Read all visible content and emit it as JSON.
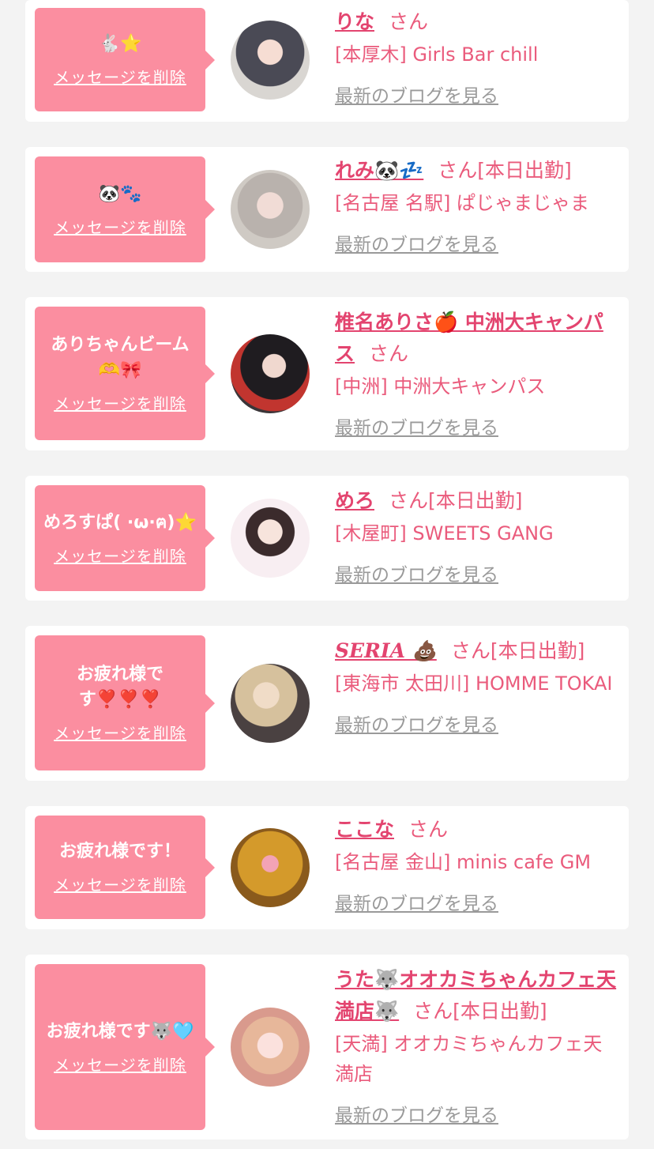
{
  "messages": [
    {
      "message": "🐇⭐",
      "delete_label": "メッセージを削除",
      "name": "りな",
      "honorific": "さん",
      "status": "",
      "shop": "[本厚木] Girls Bar chill",
      "blog_label": "最新のブログを見る"
    },
    {
      "message": "🐼🐾",
      "delete_label": "メッセージを削除",
      "name": "れみ🐼💤",
      "honorific": "さん",
      "status": "[本日出勤]",
      "shop": "[名古屋 名駅] ぱじゃまじゃま",
      "blog_label": "最新のブログを見る"
    },
    {
      "message": "ありちゃんビーム🫶🎀",
      "delete_label": "メッセージを削除",
      "name": "椎名ありさ🍎 中洲大キャンパス",
      "honorific": "さん",
      "status": "",
      "shop": "[中洲] 中洲大キャンパス",
      "blog_label": "最新のブログを見る"
    },
    {
      "message": "めろすぱ( ·ω·ฅ)⭐",
      "delete_label": "メッセージを削除",
      "name": "めろ",
      "honorific": "さん",
      "status": "[本日出勤]",
      "shop": "[木屋町] SWEETS GANG",
      "blog_label": "最新のブログを見る"
    },
    {
      "message": "お疲れ様です❣️❣️❣️",
      "delete_label": "メッセージを削除",
      "name": "SERIA 💩",
      "honorific": "さん",
      "status": "[本日出勤]",
      "shop": "[東海市 太田川] HOMME TOKAI",
      "blog_label": "最新のブログを見る"
    },
    {
      "message": "お疲れ様です！",
      "delete_label": "メッセージを削除",
      "name": "ここな",
      "honorific": "さん",
      "status": "",
      "shop": "[名古屋 金山] minis cafe GM",
      "blog_label": "最新のブログを見る"
    },
    {
      "message": "お疲れ様です🐺🩵",
      "delete_label": "メッセージを削除",
      "name": "うた🐺オオカミちゃんカフェ天満店🐺",
      "honorific": "さん",
      "status": "[本日出勤]",
      "shop": "[天満] オオカミちゃんカフェ天満店",
      "blog_label": "最新のブログを見る"
    }
  ]
}
